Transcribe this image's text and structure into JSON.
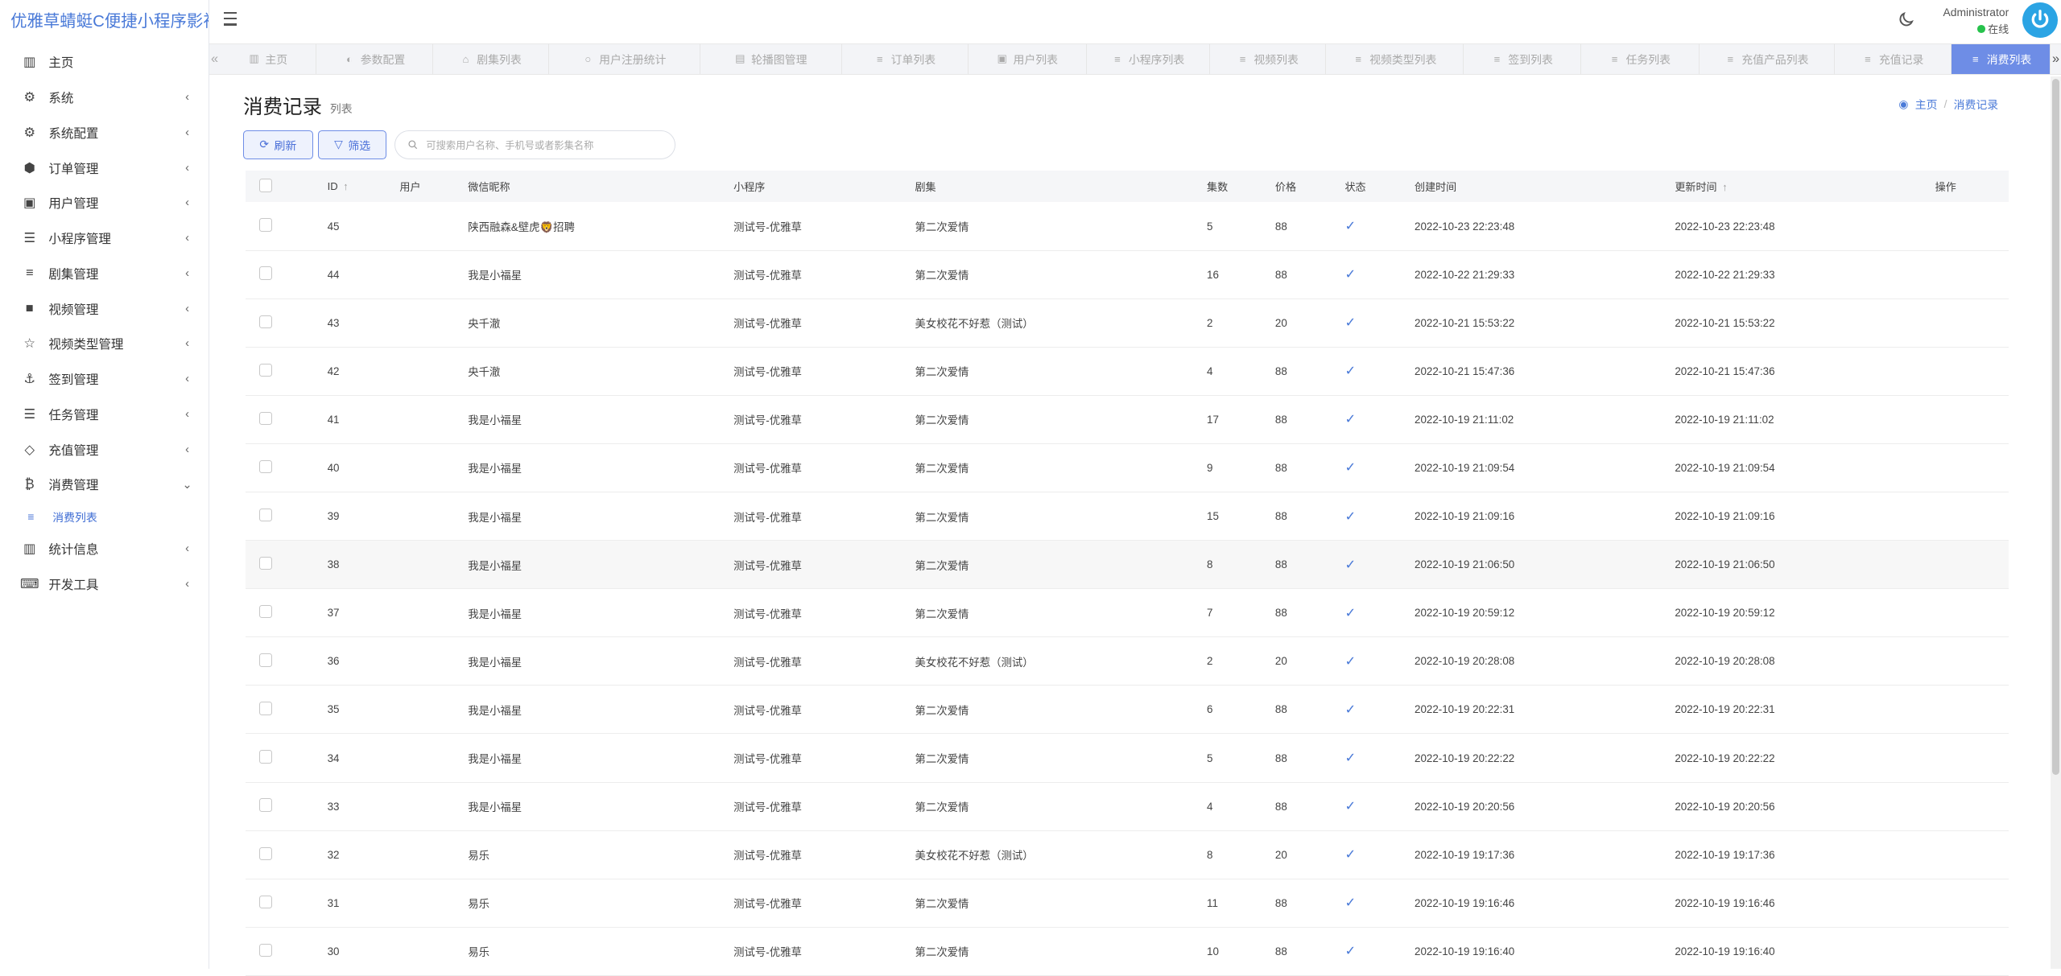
{
  "app": {
    "brand": "优雅草蜻蜓C便捷小程序影视"
  },
  "sidebar": {
    "items": [
      {
        "label": "主页",
        "icon": "dashboard-icon",
        "arrow": ""
      },
      {
        "label": "系统",
        "icon": "gear-icon",
        "arrow": "‹"
      },
      {
        "label": "系统配置",
        "icon": "gears-icon",
        "arrow": "‹"
      },
      {
        "label": "订单管理",
        "icon": "cube-icon",
        "arrow": "‹"
      },
      {
        "label": "用户管理",
        "icon": "address-book-icon",
        "arrow": "‹"
      },
      {
        "label": "小程序管理",
        "icon": "list-ol-icon",
        "arrow": "‹"
      },
      {
        "label": "剧集管理",
        "icon": "list-icon",
        "arrow": "‹"
      },
      {
        "label": "视频管理",
        "icon": "video-camera-icon",
        "arrow": "‹"
      },
      {
        "label": "视频类型管理",
        "icon": "star-half-icon",
        "arrow": "‹"
      },
      {
        "label": "签到管理",
        "icon": "anchor-icon",
        "arrow": "‹"
      },
      {
        "label": "任务管理",
        "icon": "tasks-icon",
        "arrow": "‹"
      },
      {
        "label": "充值管理",
        "icon": "diamond-icon",
        "arrow": "‹"
      },
      {
        "label": "消费管理",
        "icon": "bitcoin-icon",
        "arrow": "⌄"
      }
    ],
    "subitem": {
      "label": "消费列表",
      "icon": "list-icon"
    },
    "items_after": [
      {
        "label": "统计信息",
        "icon": "bar-chart-icon",
        "arrow": "‹"
      },
      {
        "label": "开发工具",
        "icon": "keyboard-icon",
        "arrow": "‹"
      }
    ]
  },
  "header": {
    "user_name": "Administrator",
    "user_status": "在线",
    "colors": {
      "accent": "#6e8de6",
      "brand": "#4a7ad8",
      "online": "#27c24c",
      "avatar": "#2ba4e4"
    }
  },
  "tabs": [
    {
      "label": "主页",
      "icon": "dashboard-icon"
    },
    {
      "label": "参数配置",
      "icon": "toggle-icon"
    },
    {
      "label": "剧集列表",
      "icon": "bank-icon"
    },
    {
      "label": "用户注册统计",
      "icon": "circle-icon"
    },
    {
      "label": "轮播图管理",
      "icon": "file-image-icon"
    },
    {
      "label": "订单列表",
      "icon": "list-icon"
    },
    {
      "label": "用户列表",
      "icon": "address-card-icon"
    },
    {
      "label": "小程序列表",
      "icon": "list-icon"
    },
    {
      "label": "视频列表",
      "icon": "list-icon"
    },
    {
      "label": "视频类型列表",
      "icon": "list-icon"
    },
    {
      "label": "签到列表",
      "icon": "list-icon"
    },
    {
      "label": "任务列表",
      "icon": "list-icon"
    },
    {
      "label": "充值产品列表",
      "icon": "list-icon"
    },
    {
      "label": "充值记录",
      "icon": "list-icon"
    },
    {
      "label": "消费列表",
      "icon": "list-icon",
      "active": true
    }
  ],
  "page": {
    "title": "消费记录",
    "subtitle": "列表",
    "breadcrumb": {
      "home": "主页",
      "current": "消费记录"
    }
  },
  "toolbar": {
    "refresh_label": "刷新",
    "filter_label": "筛选",
    "search_placeholder": "可搜索用户名称、手机号或者影集名称"
  },
  "table": {
    "columns": {
      "id": "ID",
      "user": "用户",
      "wechat_nickname": "微信昵称",
      "mini_program": "小程序",
      "drama": "剧集",
      "episodes": "集数",
      "price": "价格",
      "status": "状态",
      "created_at": "创建时间",
      "updated_at": "更新时间",
      "actions": "操作"
    },
    "rows": [
      {
        "id": "45",
        "user": "",
        "nickname": "陕西融森&壁虎🦁招聘",
        "app": "测试号-优雅草",
        "drama": "第二次爱情",
        "episodes": "5",
        "price": "88",
        "created": "2022-10-23 22:23:48",
        "updated": "2022-10-23 22:23:48"
      },
      {
        "id": "44",
        "user": "",
        "nickname": "我是小福星",
        "app": "测试号-优雅草",
        "drama": "第二次爱情",
        "episodes": "16",
        "price": "88",
        "created": "2022-10-22 21:29:33",
        "updated": "2022-10-22 21:29:33"
      },
      {
        "id": "43",
        "user": "",
        "nickname": "央千澈",
        "app": "测试号-优雅草",
        "drama": "美女校花不好惹（测试）",
        "episodes": "2",
        "price": "20",
        "created": "2022-10-21 15:53:22",
        "updated": "2022-10-21 15:53:22"
      },
      {
        "id": "42",
        "user": "",
        "nickname": "央千澈",
        "app": "测试号-优雅草",
        "drama": "第二次爱情",
        "episodes": "4",
        "price": "88",
        "created": "2022-10-21 15:47:36",
        "updated": "2022-10-21 15:47:36"
      },
      {
        "id": "41",
        "user": "",
        "nickname": "我是小福星",
        "app": "测试号-优雅草",
        "drama": "第二次爱情",
        "episodes": "17",
        "price": "88",
        "created": "2022-10-19 21:11:02",
        "updated": "2022-10-19 21:11:02"
      },
      {
        "id": "40",
        "user": "",
        "nickname": "我是小福星",
        "app": "测试号-优雅草",
        "drama": "第二次爱情",
        "episodes": "9",
        "price": "88",
        "created": "2022-10-19 21:09:54",
        "updated": "2022-10-19 21:09:54"
      },
      {
        "id": "39",
        "user": "",
        "nickname": "我是小福星",
        "app": "测试号-优雅草",
        "drama": "第二次爱情",
        "episodes": "15",
        "price": "88",
        "created": "2022-10-19 21:09:16",
        "updated": "2022-10-19 21:09:16"
      },
      {
        "id": "38",
        "user": "",
        "nickname": "我是小福星",
        "app": "测试号-优雅草",
        "drama": "第二次爱情",
        "episodes": "8",
        "price": "88",
        "created": "2022-10-19 21:06:50",
        "updated": "2022-10-19 21:06:50"
      },
      {
        "id": "37",
        "user": "",
        "nickname": "我是小福星",
        "app": "测试号-优雅草",
        "drama": "第二次爱情",
        "episodes": "7",
        "price": "88",
        "created": "2022-10-19 20:59:12",
        "updated": "2022-10-19 20:59:12"
      },
      {
        "id": "36",
        "user": "",
        "nickname": "我是小福星",
        "app": "测试号-优雅草",
        "drama": "美女校花不好惹（测试）",
        "episodes": "2",
        "price": "20",
        "created": "2022-10-19 20:28:08",
        "updated": "2022-10-19 20:28:08"
      },
      {
        "id": "35",
        "user": "",
        "nickname": "我是小福星",
        "app": "测试号-优雅草",
        "drama": "第二次爱情",
        "episodes": "6",
        "price": "88",
        "created": "2022-10-19 20:22:31",
        "updated": "2022-10-19 20:22:31"
      },
      {
        "id": "34",
        "user": "",
        "nickname": "我是小福星",
        "app": "测试号-优雅草",
        "drama": "第二次爱情",
        "episodes": "5",
        "price": "88",
        "created": "2022-10-19 20:22:22",
        "updated": "2022-10-19 20:22:22"
      },
      {
        "id": "33",
        "user": "",
        "nickname": "我是小福星",
        "app": "测试号-优雅草",
        "drama": "第二次爱情",
        "episodes": "4",
        "price": "88",
        "created": "2022-10-19 20:20:56",
        "updated": "2022-10-19 20:20:56"
      },
      {
        "id": "32",
        "user": "",
        "nickname": "易乐",
        "app": "测试号-优雅草",
        "drama": "美女校花不好惹（测试）",
        "episodes": "8",
        "price": "20",
        "created": "2022-10-19 19:17:36",
        "updated": "2022-10-19 19:17:36"
      },
      {
        "id": "31",
        "user": "",
        "nickname": "易乐",
        "app": "测试号-优雅草",
        "drama": "第二次爱情",
        "episodes": "11",
        "price": "88",
        "created": "2022-10-19 19:16:46",
        "updated": "2022-10-19 19:16:46"
      },
      {
        "id": "30",
        "user": "",
        "nickname": "易乐",
        "app": "测试号-优雅草",
        "drama": "第二次爱情",
        "episodes": "10",
        "price": "88",
        "created": "2022-10-19 19:16:40",
        "updated": "2022-10-19 19:16:40"
      }
    ]
  }
}
